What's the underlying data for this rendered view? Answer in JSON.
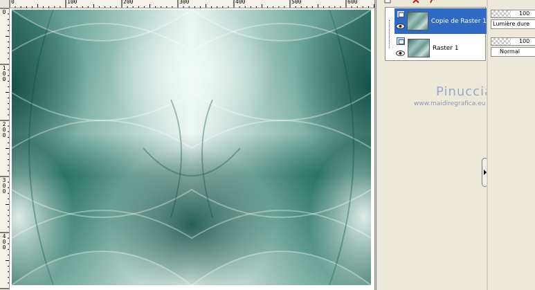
{
  "ruler_top": {
    "labels": [
      "0",
      "100",
      "200",
      "300",
      "400",
      "500",
      "600"
    ]
  },
  "ruler_left": {
    "labels": [
      [
        "0"
      ],
      [
        "1",
        "0",
        "0"
      ],
      [
        "2",
        "0",
        "0"
      ],
      [
        "3",
        "0",
        "0"
      ],
      [
        "4",
        "0",
        "0"
      ]
    ]
  },
  "layers": [
    {
      "name": "Copie de Raster 1",
      "selected": true,
      "visible": true
    },
    {
      "name": "Raster 1",
      "selected": false,
      "visible": true
    }
  ],
  "properties": [
    {
      "opacity": "100",
      "blend_mode": "Lumière dure"
    },
    {
      "opacity": "100",
      "blend_mode": "Normal"
    }
  ],
  "watermark": {
    "name": "Pinuccia",
    "url": "www.maidiregrafica.eu"
  },
  "colors": {
    "selection": "#316ac5",
    "teal_dark": "#0f5a4a",
    "teal_light": "#d6ece6"
  }
}
